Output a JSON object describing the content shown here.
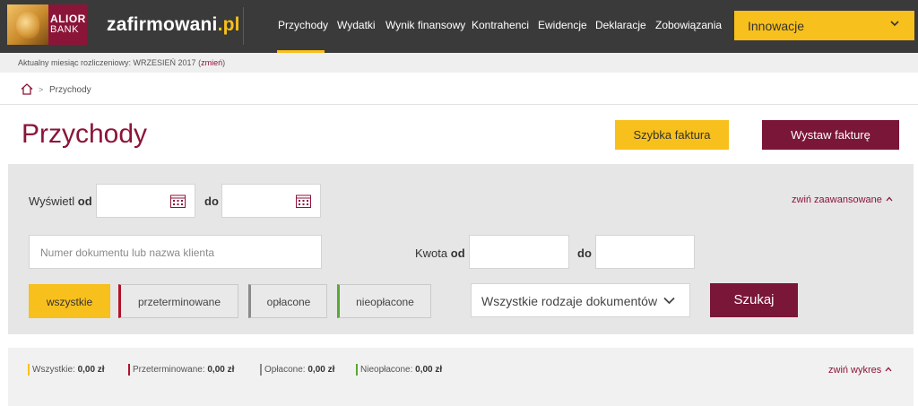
{
  "logo": {
    "line1": "ALIOR",
    "line2": "BANK"
  },
  "brand": {
    "name": "zafirmowani",
    "ext": ".pl"
  },
  "nav": {
    "items": [
      {
        "label": "Przychody",
        "active": true
      },
      {
        "label": "Wydatki"
      },
      {
        "label": "Wynik finansowy"
      },
      {
        "label": "Kontrahenci"
      },
      {
        "label": "Ewidencje"
      },
      {
        "label": "Deklaracje"
      },
      {
        "label": "Zobowiązania"
      }
    ],
    "dropdown_label": "Innowacje"
  },
  "month_strip": {
    "text": "Aktualny miesiąc rozliczeniowy: WRZESIEŃ 2017",
    "open_paren": "(",
    "change_link": "zmień",
    "close_paren": ")"
  },
  "breadcrumb": {
    "separator": ">",
    "current": "Przychody"
  },
  "page": {
    "title": "Przychody",
    "quick_invoice_label": "Szybka faktura",
    "issue_invoice_label": "Wystaw fakturę"
  },
  "filters": {
    "show_label": "Wyświetl",
    "from_label": "od",
    "to_label": "do",
    "date_from_value": "",
    "date_to_value": "",
    "search_placeholder": "Numer dokumentu lub nazwa klienta",
    "amount_label": "Kwota",
    "amount_from_label": "od",
    "amount_to_label": "do",
    "amount_from_value": "",
    "amount_to_value": "",
    "collapse_advanced": "zwiń zaawansowane",
    "status_buttons": {
      "all": "wszystkie",
      "overdue": "przeterminowane",
      "paid": "opłacone",
      "unpaid": "nieopłacone"
    },
    "doc_type_selected": "Wszystkie rodzaje dokumentów",
    "search_button": "Szukaj"
  },
  "summary": {
    "all_label": "Wszystkie:",
    "all_value": "0,00 zł",
    "overdue_label": "Przeterminowane:",
    "overdue_value": "0,00 zł",
    "paid_label": "Opłacone:",
    "paid_value": "0,00 zł",
    "unpaid_label": "Nieopłacone:",
    "unpaid_value": "0,00 zł",
    "collapse_chart": "zwiń wykres"
  },
  "colors": {
    "brand_dark": "#3a3a3a",
    "accent_yellow": "#f8c01c",
    "accent_maroon": "#7a1638",
    "overdue": "#b0122a",
    "paid": "#8a8a8a",
    "unpaid": "#5aa832"
  },
  "icons": [
    "home-icon",
    "calendar-icon",
    "chevron-down-icon",
    "chevron-up-icon"
  ]
}
